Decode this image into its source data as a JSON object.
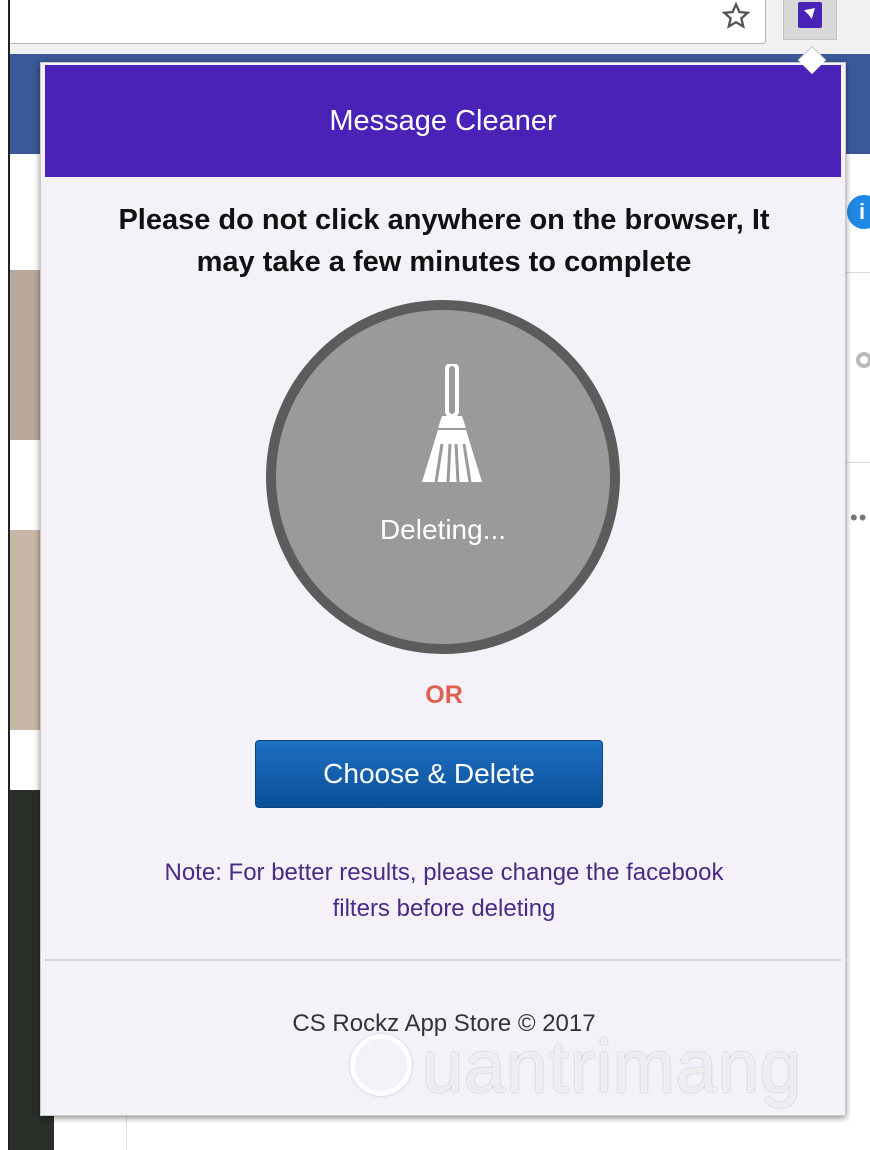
{
  "popup": {
    "title": "Message Cleaner",
    "warning_line1": "Please do not click anywhere on the browser, It",
    "warning_line2": "may take a few minutes to complete",
    "status": "Deleting...",
    "or_label": "OR",
    "choose_button": "Choose & Delete",
    "note_line1": "Note: For better results, please change the facebook",
    "note_line2": "filters before deleting",
    "footer": "CS Rockz App Store © 2017"
  },
  "watermark": {
    "text": "uantrimang"
  },
  "colors": {
    "header_bg": "#4b22b8",
    "button_bg": "#0a4f98",
    "or_text": "#e0604e",
    "note_text": "#4b2a86",
    "circle_fill": "#9a9a9a",
    "circle_ring": "#5c5c5c"
  },
  "icons": [
    "star-icon",
    "message-cleaner-extension-icon",
    "broom-icon",
    "info-icon",
    "gear-icon",
    "more-icon",
    "lightbulb-icon"
  ]
}
